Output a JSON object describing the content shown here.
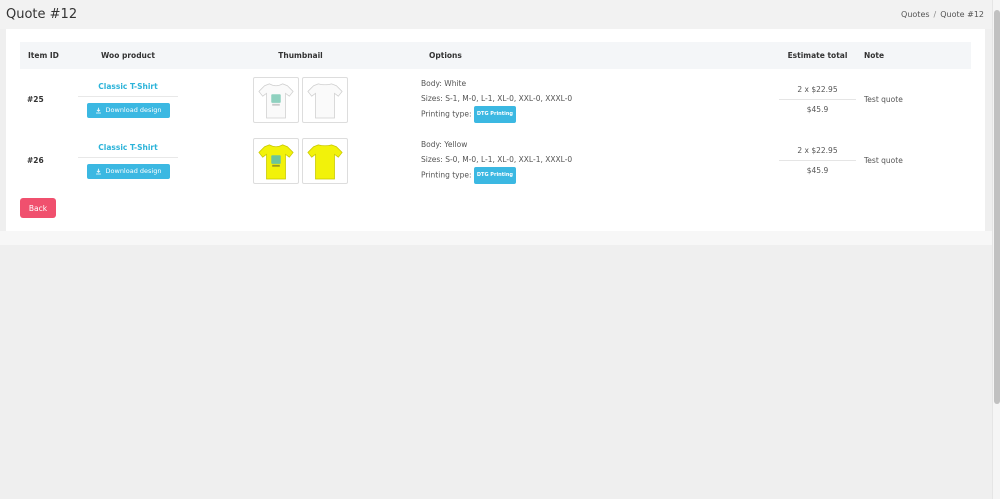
{
  "header": {
    "title": "Quote #12",
    "breadcrumb": {
      "parent": "Quotes",
      "separator": "/",
      "current": "Quote #12"
    }
  },
  "table": {
    "columns": [
      "Item ID",
      "Woo product",
      "Thumbnail",
      "Options",
      "Estimate total",
      "Note"
    ],
    "rows": [
      {
        "id": "#25",
        "product": "Classic T-Shirt",
        "download_label": "Download design",
        "thumb_color": "#ffffff",
        "options": {
          "body": "Body: White",
          "sizes": "Sizes: S-1, M-0, L-1, XL-0, XXL-0, XXXL-0",
          "printing_label": "Printing type:",
          "printing_badge": "DTG Printing"
        },
        "estimate_qty": "2 x $22.95",
        "estimate_total": "$45.9",
        "note": "Test quote"
      },
      {
        "id": "#26",
        "product": "Classic T-Shirt",
        "download_label": "Download design",
        "thumb_color": "#f2f20a",
        "options": {
          "body": "Body: Yellow",
          "sizes": "Sizes: S-0, M-0, L-1, XL-0, XXL-1, XXXL-0",
          "printing_label": "Printing type:",
          "printing_badge": "DTG Printing"
        },
        "estimate_qty": "2 x $22.95",
        "estimate_total": "$45.9",
        "note": "Test quote"
      }
    ]
  },
  "back_button": "Back",
  "colors": {
    "accent": "#3bb8e2",
    "link": "#2bb3d9",
    "danger": "#f0506e"
  }
}
